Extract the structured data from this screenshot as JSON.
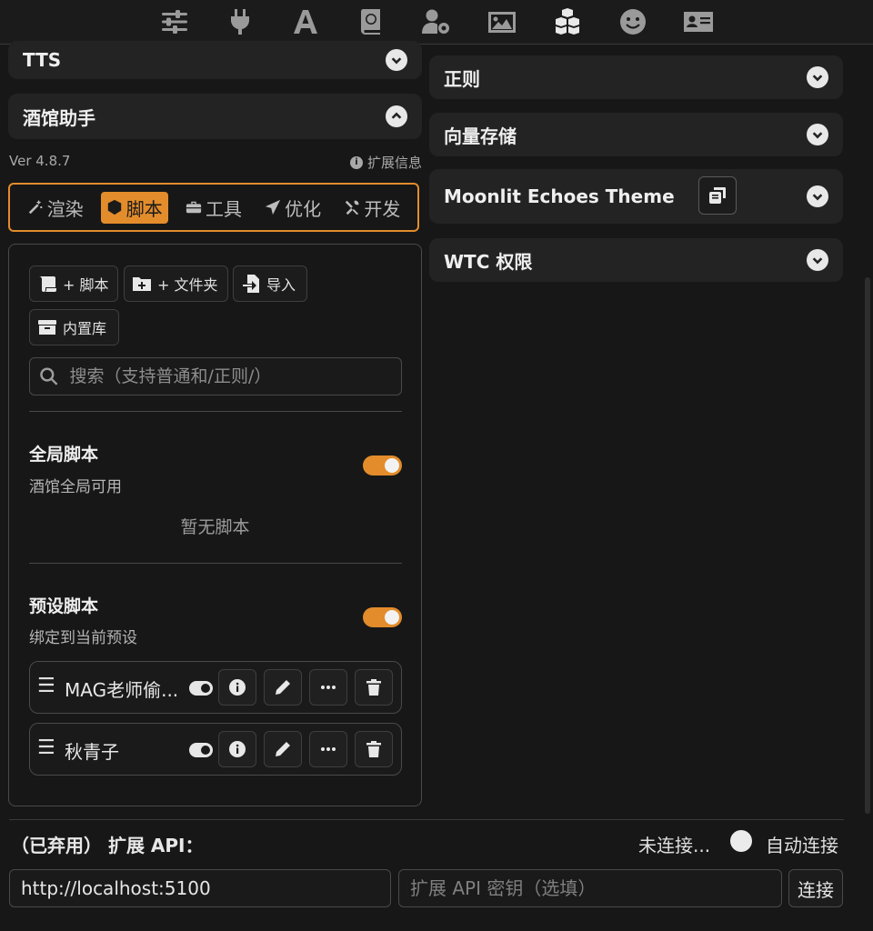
{
  "topbar": {
    "icons": [
      "sliders-icon",
      "plug-icon",
      "font-icon",
      "book-icon",
      "user-gear-icon",
      "image-icon",
      "cubes-icon",
      "smile-icon",
      "id-card-icon"
    ],
    "active": "cubes-icon"
  },
  "left": {
    "tts_title": "TTS",
    "helper_title": "酒馆助手",
    "version": "Ver 4.8.7",
    "ext_info": "扩展信息",
    "tabs": [
      {
        "label": "渲染",
        "icon": "wand-icon"
      },
      {
        "label": "脚本",
        "icon": "cube-icon"
      },
      {
        "label": "工具",
        "icon": "toolbox-icon"
      },
      {
        "label": "优化",
        "icon": "send-icon"
      },
      {
        "label": "开发",
        "icon": "tools-icon"
      }
    ],
    "active_tab": "脚本",
    "buttons": {
      "add_script": "+ 脚本",
      "add_folder": "+ 文件夹",
      "import": "导入",
      "builtin": "内置库"
    },
    "search_placeholder": "搜索（支持普通和/正则/）",
    "global": {
      "title": "全局脚本",
      "subtitle": "酒馆全局可用",
      "enabled": true,
      "empty": "暂无脚本"
    },
    "preset": {
      "title": "预设脚本",
      "subtitle": "绑定到当前预设",
      "enabled": true,
      "items": [
        {
          "name": "MAG老师偷..."
        },
        {
          "name": "秋青子"
        }
      ]
    }
  },
  "right": {
    "drawers": [
      "正则",
      "向量存储",
      "Moonlit Echoes Theme",
      "WTC 权限"
    ]
  },
  "footer": {
    "api_label": "（已弃用） 扩展 API：",
    "status": "未连接...",
    "auto_connect": "自动连接",
    "url_value": "http://localhost:5100",
    "key_placeholder": "扩展 API 密钥（选填）",
    "connect": "连接"
  },
  "colors": {
    "accent": "#e38c2b",
    "background": "#171717",
    "panel": "#232323"
  }
}
